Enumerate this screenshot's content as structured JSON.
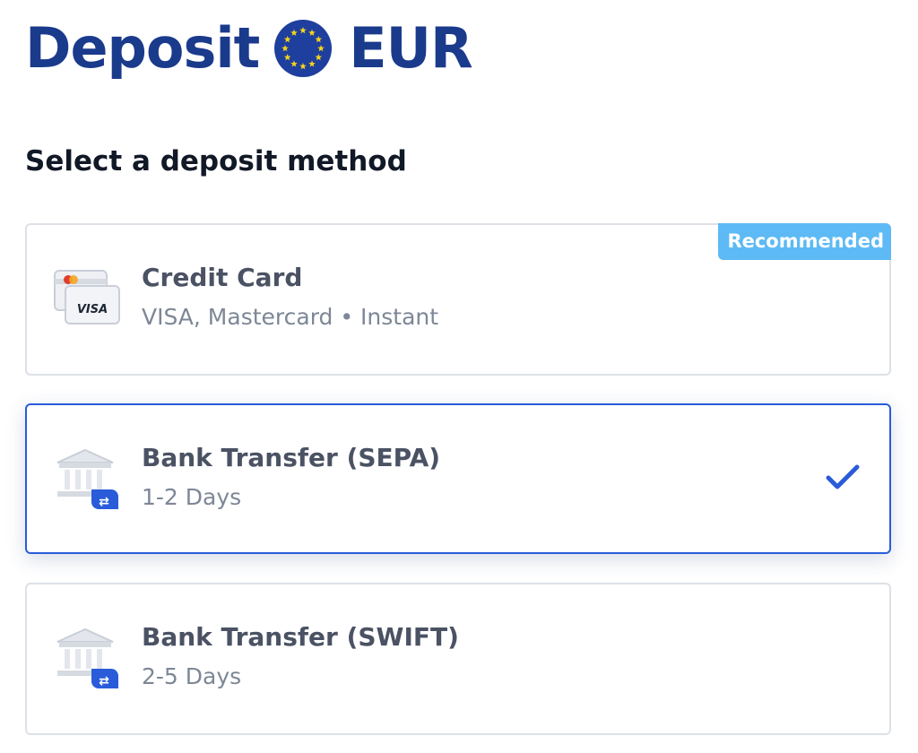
{
  "header": {
    "title_prefix": "Deposit",
    "currency": "EUR",
    "flag_icon": "eu-flag-icon"
  },
  "section": {
    "title": "Select a deposit method"
  },
  "methods": [
    {
      "title": "Credit Card",
      "subtitle": "VISA, Mastercard • Instant",
      "badge": "Recommended",
      "icon": "credit-card-icon",
      "card_label": "VISA",
      "selected": false
    },
    {
      "title": "Bank Transfer (SEPA)",
      "subtitle": "1-2 Days",
      "icon": "bank-transfer-icon",
      "selected": true
    },
    {
      "title": "Bank Transfer (SWIFT)",
      "subtitle": "2-5 Days",
      "icon": "bank-transfer-icon",
      "selected": false
    }
  ],
  "colors": {
    "brand": "#1a3a8c",
    "selected_border": "#2a5cd9",
    "badge": "#5dbaf5",
    "check": "#2a5cd9"
  }
}
